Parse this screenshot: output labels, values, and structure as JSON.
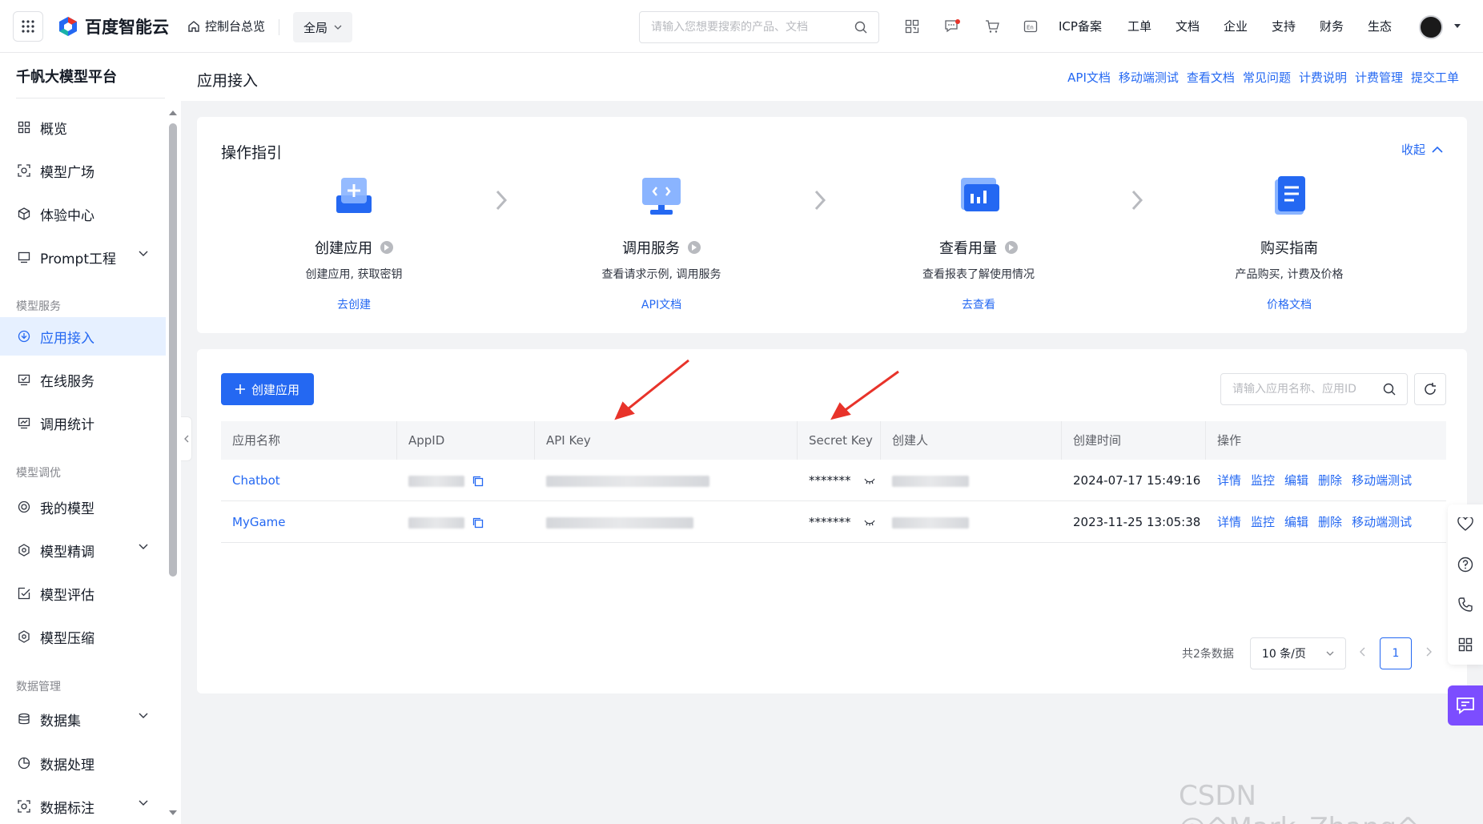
{
  "topbar": {
    "brand": "百度智能云",
    "home": "控制台总览",
    "scope": "全局",
    "search_placeholder": "请输入您想要搜索的产品、文档",
    "nav": [
      "ICP备案",
      "工单",
      "文档",
      "企业",
      "支持",
      "财务",
      "生态"
    ]
  },
  "sidebar": {
    "title": "千帆大模型平台",
    "items": [
      {
        "label": "概览"
      },
      {
        "label": "模型广场"
      },
      {
        "label": "体验中心"
      },
      {
        "label": "Prompt工程"
      },
      {
        "label": "应用接入"
      },
      {
        "label": "在线服务"
      },
      {
        "label": "调用统计"
      },
      {
        "label": "我的模型"
      },
      {
        "label": "模型精调"
      },
      {
        "label": "模型评估"
      },
      {
        "label": "模型压缩"
      },
      {
        "label": "数据集"
      },
      {
        "label": "数据处理"
      },
      {
        "label": "数据标注"
      }
    ],
    "groups": [
      "模型服务",
      "模型调优",
      "数据管理"
    ]
  },
  "page": {
    "title": "应用接入",
    "links": [
      "API文档",
      "移动端测试",
      "查看文档",
      "常见问题",
      "计费说明",
      "计费管理",
      "提交工单"
    ]
  },
  "guide": {
    "title": "操作指引",
    "collapse": "收起",
    "steps": [
      {
        "name": "创建应用",
        "desc": "创建应用, 获取密钥",
        "link": "去创建"
      },
      {
        "name": "调用服务",
        "desc": "查看请求示例, 调用服务",
        "link": "API文档"
      },
      {
        "name": "查看用量",
        "desc": "查看报表了解使用情况",
        "link": "去查看"
      },
      {
        "name": "购买指南",
        "desc": "产品购买, 计费及价格",
        "link": "价格文档"
      }
    ]
  },
  "table": {
    "create_button": "创建应用",
    "search_placeholder": "请输入应用名称、应用ID",
    "columns": [
      "应用名称",
      "AppID",
      "API Key",
      "Secret Key",
      "创建人",
      "创建时间",
      "操作"
    ],
    "rows": [
      {
        "name": "Chatbot",
        "secret": "*******",
        "created": "2024-07-17 15:49:16"
      },
      {
        "name": "MyGame",
        "secret": "*******",
        "created": "2023-11-25 13:05:38"
      }
    ],
    "actions": [
      "详情",
      "监控",
      "编辑",
      "删除",
      "移动端测试"
    ]
  },
  "pager": {
    "total": "共2条数据",
    "page_size": "10 条/页",
    "current": "1"
  },
  "watermark": "CSDN @^Mark_Zhang^",
  "colors": {
    "primary": "#2468f2",
    "annotation": "#e8332a",
    "chat": "#7c4dff"
  }
}
